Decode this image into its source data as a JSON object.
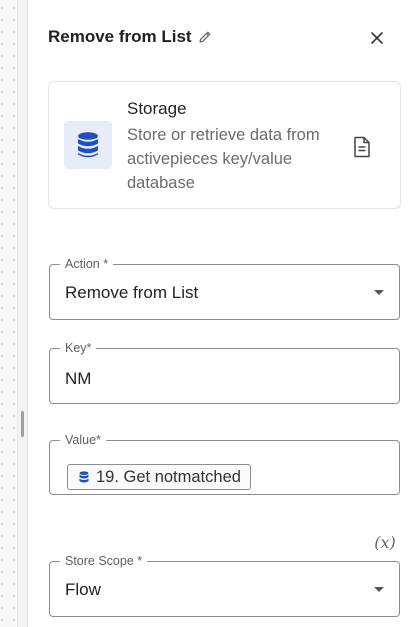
{
  "header": {
    "title": "Remove from List"
  },
  "piece": {
    "name": "Storage",
    "description": "Store or retrieve data from activepieces key/value database"
  },
  "fields": {
    "action": {
      "label": "Action *",
      "value": "Remove from List"
    },
    "key": {
      "label": "Key*",
      "value": "NM"
    },
    "value": {
      "label": "Value*",
      "chip": "19. Get notmatched"
    },
    "store_scope": {
      "label": "Store Scope *",
      "value": "Flow",
      "toggle": "(x)"
    }
  },
  "icons": {
    "pencil": "pencil-icon",
    "close": "close-icon",
    "logo": "database-icon",
    "doc": "document-icon",
    "chip": "database-icon",
    "caret": "chevron-down-icon"
  },
  "colors": {
    "brand": "#1f4fbf",
    "logo_bg": "#e7ecf8",
    "border": "#8c8c91"
  }
}
